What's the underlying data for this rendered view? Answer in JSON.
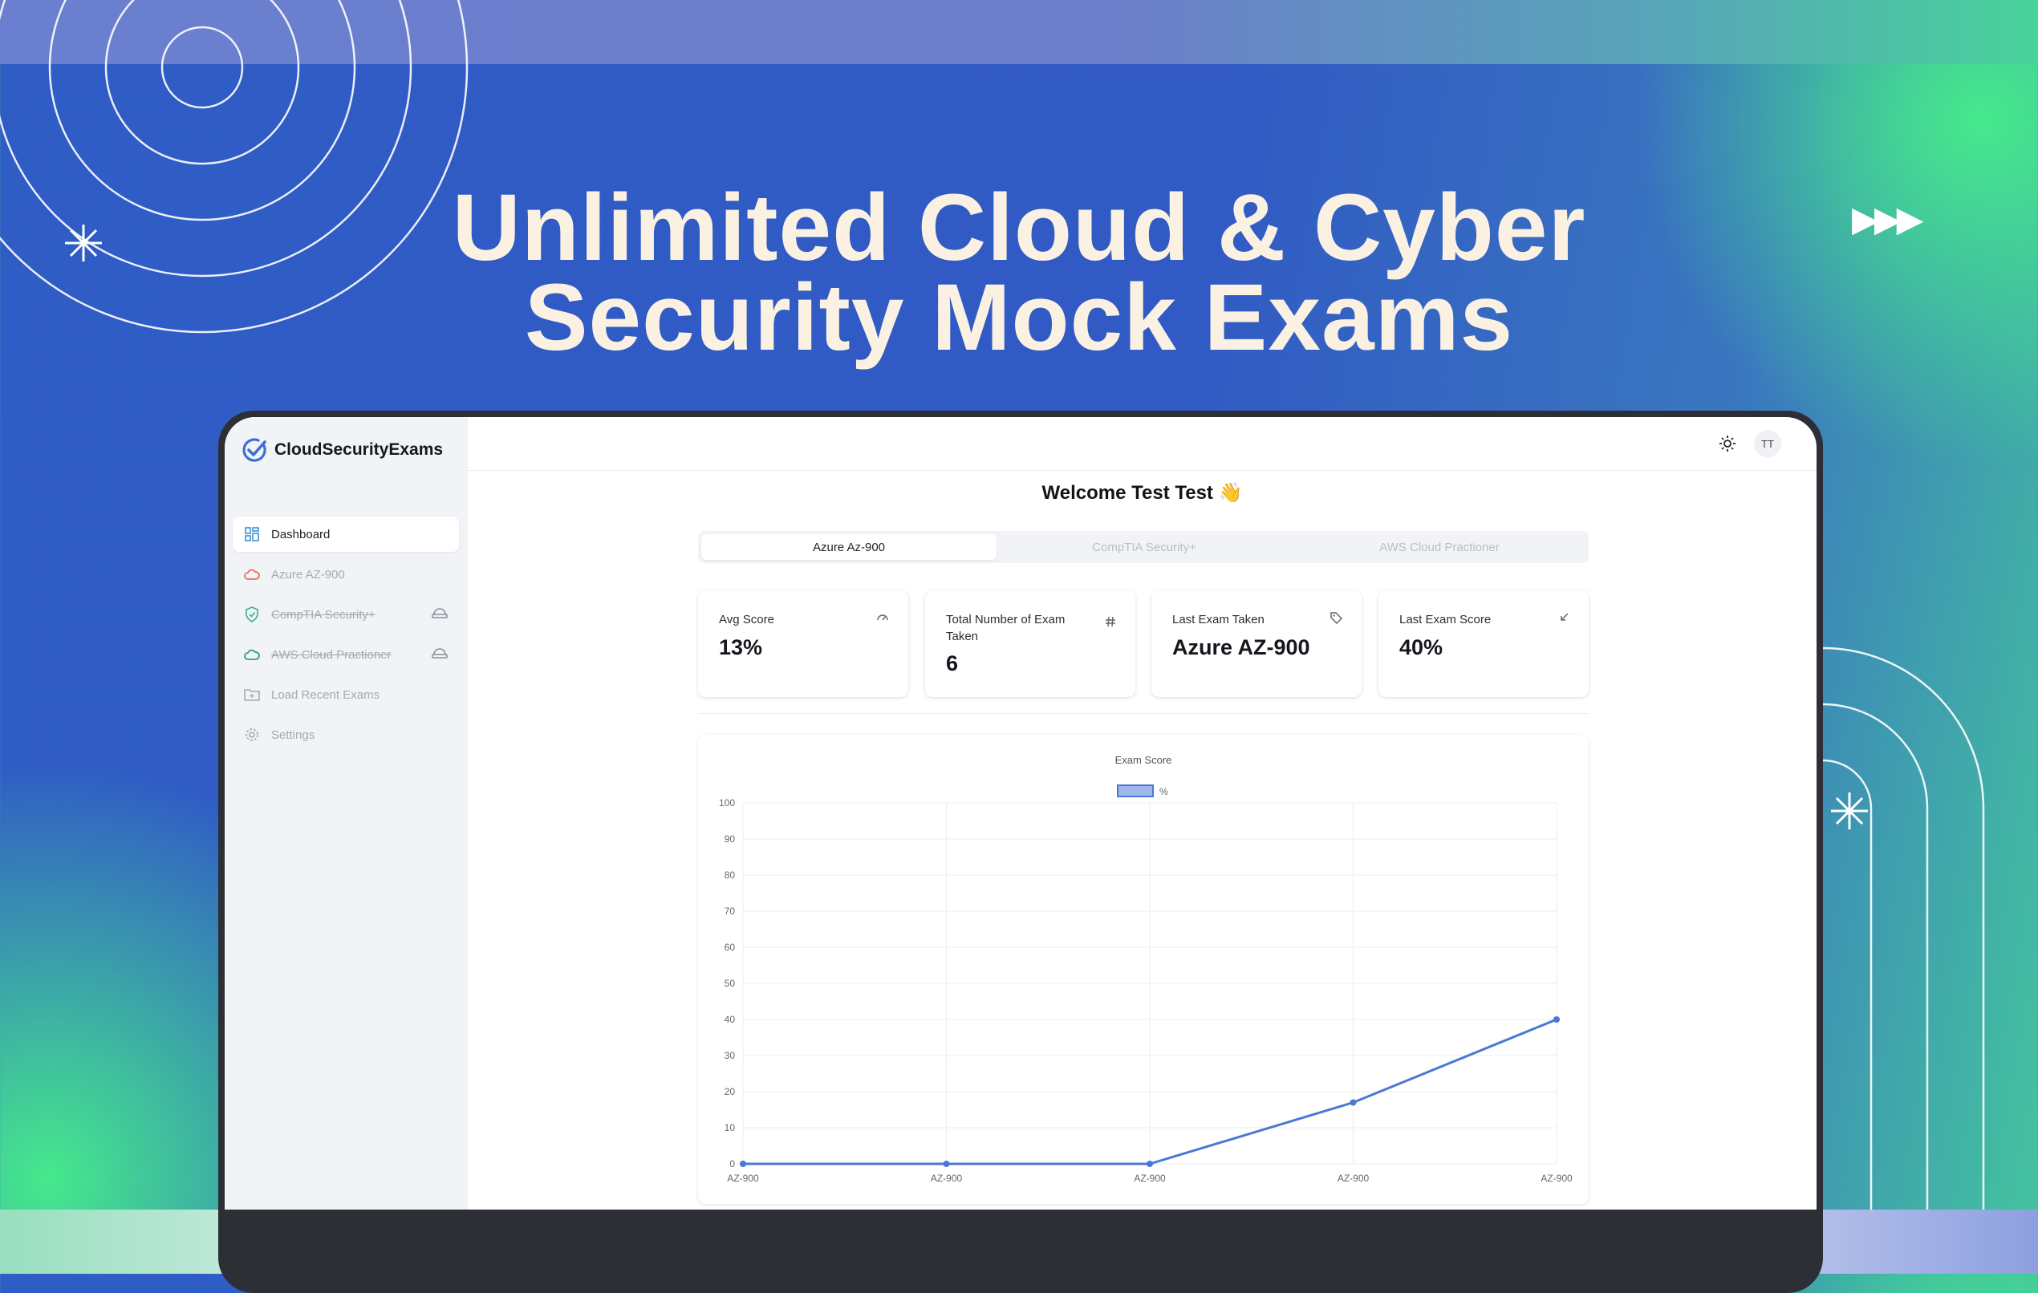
{
  "headline": {
    "line1": "Unlimited Cloud & Cyber",
    "line2": "Security Mock Exams"
  },
  "colors": {
    "accent": "#4a78d6",
    "background": "#305cc6",
    "headline": "#fbf1e3"
  },
  "brand": {
    "name": "CloudSecurityExams",
    "icon": "check-circle-icon"
  },
  "sidebar": {
    "items": [
      {
        "label": "Dashboard",
        "icon": "grid-icon",
        "active": true
      },
      {
        "label": "Azure AZ-900",
        "icon": "cloud-icon"
      },
      {
        "label": "CompTIA Security+",
        "icon": "shield-check-icon",
        "locked": true
      },
      {
        "label": "AWS Cloud Practioner",
        "icon": "cloud-icon",
        "locked": true
      },
      {
        "label": "Load Recent Exams",
        "icon": "folder-icon"
      },
      {
        "label": "Settings",
        "icon": "gear-icon"
      }
    ]
  },
  "header": {
    "theme_icon": "sun-icon",
    "avatar": "TT"
  },
  "welcome": "Welcome Test Test 👋",
  "tabs": [
    {
      "label": "Azure Az-900",
      "active": true
    },
    {
      "label": "CompTIA Security+"
    },
    {
      "label": "AWS Cloud Practioner"
    }
  ],
  "stats": [
    {
      "label": "Avg Score",
      "value": "13%",
      "icon": "gauge-icon"
    },
    {
      "label": "Total Number of Exam Taken",
      "value": "6",
      "icon": "hash-icon"
    },
    {
      "label": "Last Exam Taken",
      "value": "Azure AZ-900",
      "icon": "tag-icon"
    },
    {
      "label": "Last Exam Score",
      "value": "40%",
      "icon": "arrow-down-left-icon"
    }
  ],
  "chart_data": {
    "type": "line",
    "title": "Exam Score",
    "legend": [
      "%"
    ],
    "categories": [
      "AZ-900",
      "AZ-900",
      "AZ-900",
      "AZ-900",
      "AZ-900"
    ],
    "series": [
      {
        "name": "%",
        "values": [
          0,
          0,
          0,
          17,
          40
        ],
        "color": "#4a78d6"
      }
    ],
    "ylim": [
      0,
      100
    ],
    "yticks": [
      "0",
      "10",
      "20",
      "30",
      "40",
      "50",
      "60",
      "70",
      "80",
      "90",
      "100"
    ],
    "grid": true,
    "legend_position": "top"
  }
}
